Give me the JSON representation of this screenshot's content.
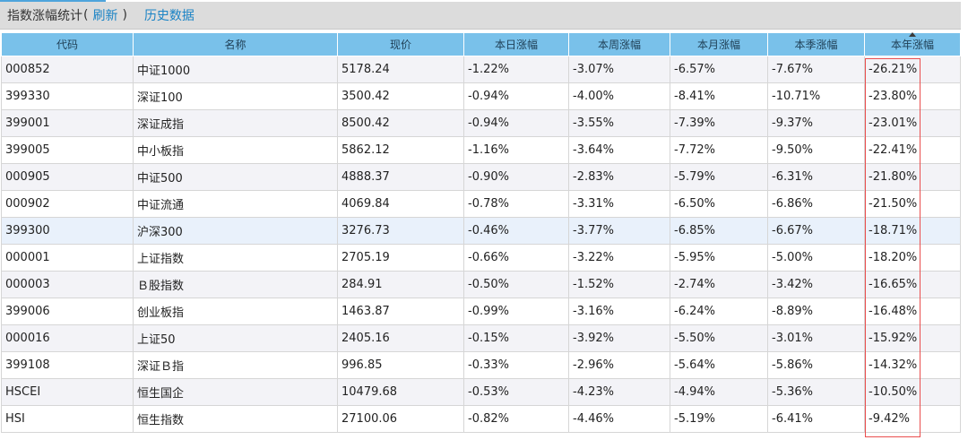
{
  "header": {
    "title": "指数涨幅统计",
    "open_paren": "(",
    "refresh": "刷新",
    "close_paren": ")",
    "history": "历史数据"
  },
  "table": {
    "columns": [
      "代码",
      "名称",
      "现价",
      "本日涨幅",
      "本周涨幅",
      "本月涨幅",
      "本季涨幅",
      "本年涨幅"
    ],
    "sorted_column": "本年涨幅",
    "sort_direction": "ascending-arrow-shown",
    "highlight_color": "#ea4e4e",
    "negative_color": "#1a8a1a",
    "link_color": "#1a83c5",
    "rows": [
      {
        "code": "000852",
        "name": "中证1000",
        "price": "5178.24",
        "day": "-1.22%",
        "week": "-3.07%",
        "month": "-6.57%",
        "quarter": "-7.67%",
        "year": "-26.21%"
      },
      {
        "code": "399330",
        "name": "深证100",
        "price": "3500.42",
        "day": "-0.94%",
        "week": "-4.00%",
        "month": "-8.41%",
        "quarter": "-10.71%",
        "year": "-23.80%"
      },
      {
        "code": "399001",
        "name": "深证成指",
        "price": "8500.42",
        "day": "-0.94%",
        "week": "-3.55%",
        "month": "-7.39%",
        "quarter": "-9.37%",
        "year": "-23.01%"
      },
      {
        "code": "399005",
        "name": "中小板指",
        "price": "5862.12",
        "day": "-1.16%",
        "week": "-3.64%",
        "month": "-7.72%",
        "quarter": "-9.50%",
        "year": "-22.41%"
      },
      {
        "code": "000905",
        "name": "中证500",
        "price": "4888.37",
        "day": "-0.90%",
        "week": "-2.83%",
        "month": "-5.79%",
        "quarter": "-6.31%",
        "year": "-21.80%"
      },
      {
        "code": "000902",
        "name": "中证流通",
        "price": "4069.84",
        "day": "-0.78%",
        "week": "-3.31%",
        "month": "-6.50%",
        "quarter": "-6.86%",
        "year": "-21.50%"
      },
      {
        "code": "399300",
        "name": "沪深300",
        "price": "3276.73",
        "day": "-0.46%",
        "week": "-3.77%",
        "month": "-6.85%",
        "quarter": "-6.67%",
        "year": "-18.71%"
      },
      {
        "code": "000001",
        "name": "上证指数",
        "price": "2705.19",
        "day": "-0.66%",
        "week": "-3.22%",
        "month": "-5.95%",
        "quarter": "-5.00%",
        "year": "-18.20%"
      },
      {
        "code": "000003",
        "name": "Ｂ股指数",
        "price": "284.91",
        "day": "-0.50%",
        "week": "-1.52%",
        "month": "-2.74%",
        "quarter": "-3.42%",
        "year": "-16.65%"
      },
      {
        "code": "399006",
        "name": "创业板指",
        "price": "1463.87",
        "day": "-0.99%",
        "week": "-3.16%",
        "month": "-6.24%",
        "quarter": "-8.89%",
        "year": "-16.48%"
      },
      {
        "code": "000016",
        "name": "上证50",
        "price": "2405.16",
        "day": "-0.15%",
        "week": "-3.92%",
        "month": "-5.50%",
        "quarter": "-3.01%",
        "year": "-15.92%"
      },
      {
        "code": "399108",
        "name": "深证Ｂ指",
        "price": "996.85",
        "day": "-0.33%",
        "week": "-2.96%",
        "month": "-5.64%",
        "quarter": "-5.86%",
        "year": "-14.32%"
      },
      {
        "code": "HSCEI",
        "name": "恒生国企",
        "price": "10479.68",
        "day": "-0.53%",
        "week": "-4.23%",
        "month": "-4.94%",
        "quarter": "-5.36%",
        "year": "-10.50%"
      },
      {
        "code": "HSI",
        "name": "恒生指数",
        "price": "27100.06",
        "day": "-0.82%",
        "week": "-4.46%",
        "month": "-5.19%",
        "quarter": "-6.41%",
        "year": "-9.42%"
      }
    ]
  }
}
